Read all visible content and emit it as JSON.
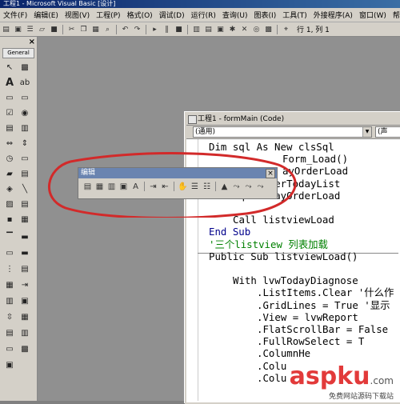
{
  "window": {
    "title": "工程1 - Microsoft Visual Basic [设计]"
  },
  "menu": [
    "文件(F)",
    "编辑(E)",
    "视图(V)",
    "工程(P)",
    "格式(O)",
    "调试(D)",
    "运行(R)",
    "查询(U)",
    "图表(I)",
    "工具(T)",
    "外接程序(A)",
    "窗口(W)",
    "帮助(H)"
  ],
  "toolbar": {
    "position": "行 1, 列 1"
  },
  "toolbox": {
    "title": "General",
    "close": "×"
  },
  "code_window": {
    "title": "工程1 - formMain (Code)",
    "object_combo": "(通用)",
    "proc_combo": "(声"
  },
  "code": {
    "line1": "Dim sql As New clsSql",
    "line2": "Form_Load()",
    "line3": "ayOrderLoad",
    "line4": "sql.OrderTodayList",
    "line5": "sql.TodayOrderLoad",
    "line6": "Call listviewLoad",
    "line7": "End Sub",
    "line8": "'三个listview 列表加载",
    "line9": "Public Sub listviewLoad()",
    "line10": "With lvwTodayDiagnose",
    "line11": ".ListItems.Clear '什么作",
    "line12": ".GridLines = True '显示",
    "line13": ".View = lvwReport",
    "line14": ".FlatScrollBar = False",
    "line15": ".FullRowSelect = T",
    "line16": ".ColumnHe",
    "line17": ".Colu",
    "line18": ".Colu"
  },
  "edit_toolbar": {
    "title": "编辑",
    "close": "×"
  },
  "watermark": {
    "main": "aspku",
    "suffix": ".com",
    "sub": "免费网站源码下载站"
  },
  "colors": {
    "annotation": "#d22a2a",
    "keyword": "#00008b",
    "comment": "#008000"
  }
}
